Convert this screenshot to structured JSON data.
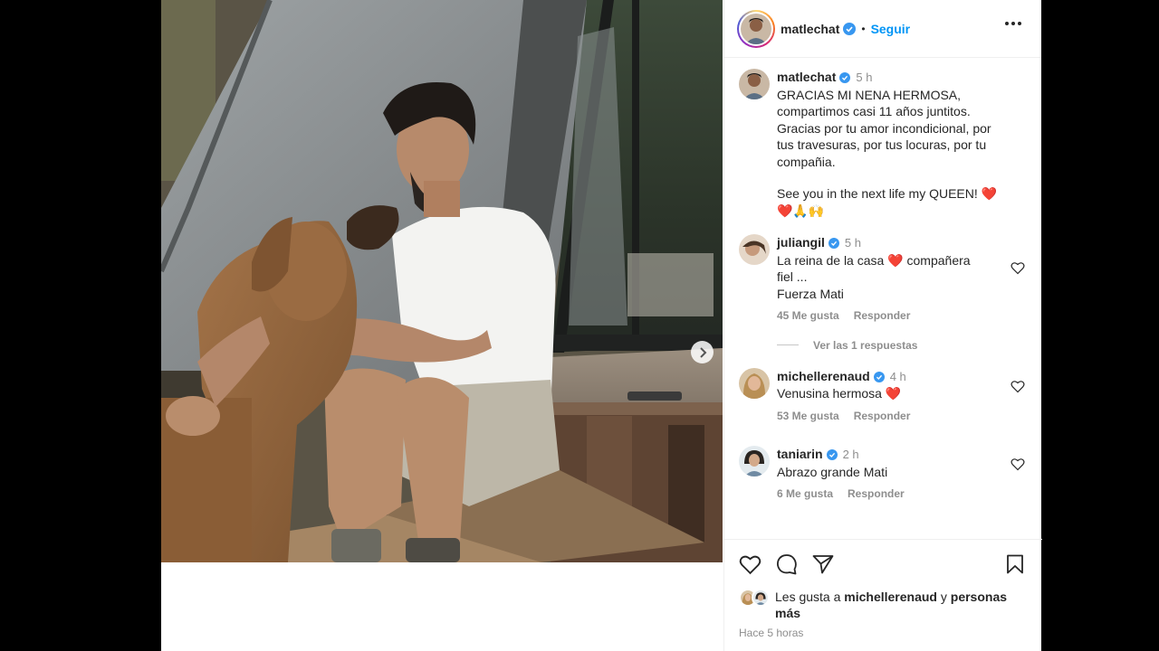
{
  "post": {
    "author": "matlechat",
    "follow_label": "Seguir",
    "caption": {
      "username": "matlechat",
      "time": "5 h",
      "lines": [
        "GRACIAS MI NENA HERMOSA,",
        "compartimos casi 11 años juntitos.",
        "Gracias por tu amor incondicional, por",
        "tus travesuras, por tus locuras, por tu",
        "compañia.",
        "",
        "See you in the next life my QUEEN! ❤️",
        "❤️🙏🙌"
      ]
    },
    "comments": [
      {
        "username": "juliangil",
        "time": "5 h",
        "lines": [
          "La reina de la casa ❤️ compañera",
          "fiel ...",
          "Fuerza Mati"
        ],
        "likes": "45 Me gusta",
        "reply": "Responder"
      },
      {
        "username": "michellerenaud",
        "time": "4 h",
        "lines": [
          "Venusina hermosa ❤️"
        ],
        "likes": "53 Me gusta",
        "reply": "Responder"
      },
      {
        "username": "taniarin",
        "time": "2 h",
        "lines": [
          "Abrazo grande Mati"
        ],
        "likes": "6 Me gusta",
        "reply": "Responder"
      }
    ],
    "view_replies": "Ver las 1 respuestas",
    "liked_by": {
      "prefix": "Les gusta a",
      "user": "michellerenaud",
      "connector": "y",
      "others": "personas",
      "others_2": "más"
    },
    "posted_ago": "Hace 5 horas"
  },
  "icons": {
    "verified": "verified-badge-icon",
    "more": "more-options-icon",
    "like": "heart-icon",
    "comment": "comment-icon",
    "share": "share-icon",
    "save": "bookmark-icon",
    "next": "chevron-right-icon"
  },
  "colors": {
    "link_blue": "#0095f6",
    "verified_blue": "#3897f0",
    "muted": "#8e8e8e",
    "text": "#262626"
  }
}
